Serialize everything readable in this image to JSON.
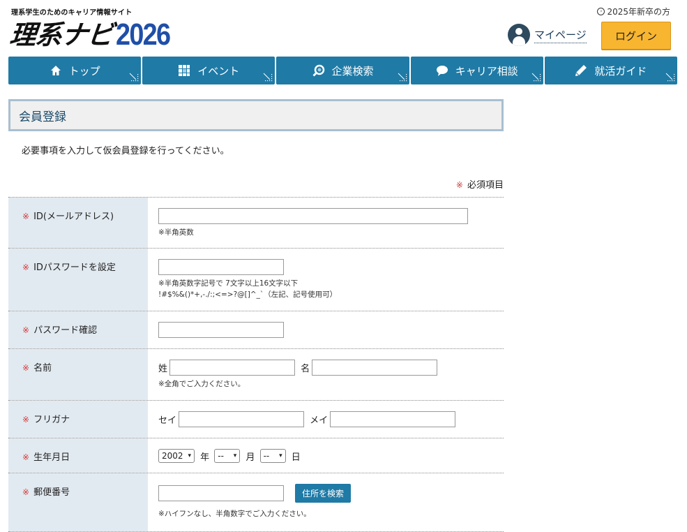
{
  "header": {
    "tagline": "理系学生のためのキャリア情報サイト",
    "logo_text": "理系ナビ",
    "logo_year": "2026",
    "grad_link": "2025年新卒の方",
    "mypage_label": "マイページ",
    "login_label": "ログイン"
  },
  "nav": {
    "items": [
      {
        "label": "トップ",
        "icon": "home-icon"
      },
      {
        "label": "イベント",
        "icon": "calendar-icon"
      },
      {
        "label": "企業検索",
        "icon": "search-icon"
      },
      {
        "label": "キャリア相談",
        "icon": "chat-bubble-icon"
      },
      {
        "label": "就活ガイド",
        "icon": "pencil-icon"
      }
    ]
  },
  "page": {
    "title": "会員登録",
    "intro": "必要事項を入力して仮会員登録を行ってください。",
    "required_mark": "※",
    "required_note": "必須項目"
  },
  "form": {
    "id": {
      "label": "ID(メールアドレス)",
      "value": "",
      "hint": "※半角英数"
    },
    "password": {
      "label": "IDパスワードを設定",
      "value": "",
      "hint1": "※半角英数字記号で 7文字以上16文字以下",
      "hint2": "!#$%&()*+,-./:;<=>?@[]^_`（左記、記号使用可）"
    },
    "password_confirm": {
      "label": "パスワード確認",
      "value": ""
    },
    "name": {
      "label": "名前",
      "last_label": "姓",
      "first_label": "名",
      "last_value": "",
      "first_value": "",
      "hint": "※全角でご入力ください。"
    },
    "kana": {
      "label": "フリガナ",
      "last_label": "セイ",
      "first_label": "メイ",
      "last_value": "",
      "first_value": ""
    },
    "birthday": {
      "label": "生年月日",
      "year": "2002",
      "year_unit": "年",
      "month": "--",
      "month_unit": "月",
      "day": "--",
      "day_unit": "日"
    },
    "postal": {
      "label": "郵便番号",
      "value": "",
      "button": "住所を検索",
      "hint": "※ハイフンなし、半角数字でご入力ください。"
    }
  },
  "colors": {
    "nav_bg": "#1f7aa6",
    "login_bg": "#f8b530",
    "logo_year": "#1f4fa8",
    "required_mark": "#d23a3a",
    "label_bg": "#e2eaf1"
  }
}
